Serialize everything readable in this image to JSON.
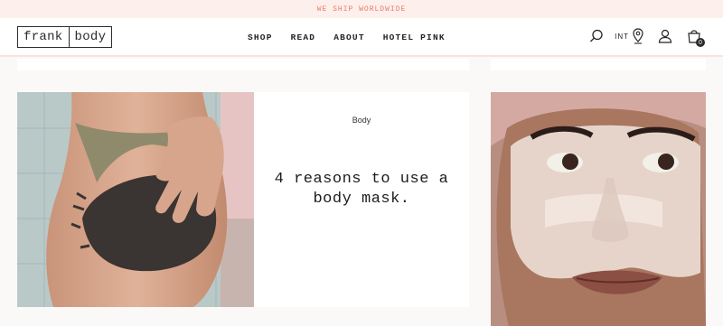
{
  "promo_bar": {
    "text": "WE SHIP WORLDWIDE"
  },
  "header": {
    "logo": {
      "left": "frank",
      "right": "body"
    },
    "nav": [
      {
        "label": "SHOP"
      },
      {
        "label": "READ"
      },
      {
        "label": "ABOUT"
      },
      {
        "label": "HOTEL PINK"
      }
    ],
    "region_label": "INT",
    "cart_count": "0",
    "icons": [
      "search-icon",
      "location-pin-icon",
      "account-icon",
      "cart-icon"
    ]
  },
  "featured": {
    "tag": "Body",
    "title": "4 reasons to use a body mask.",
    "images": [
      "body-scrub-photo",
      "face-mask-photo"
    ]
  },
  "colors": {
    "promo_bg": "#fdf0ec",
    "promo_text": "#e87a63",
    "page_bg": "#fbf9f7",
    "text": "#222222"
  }
}
